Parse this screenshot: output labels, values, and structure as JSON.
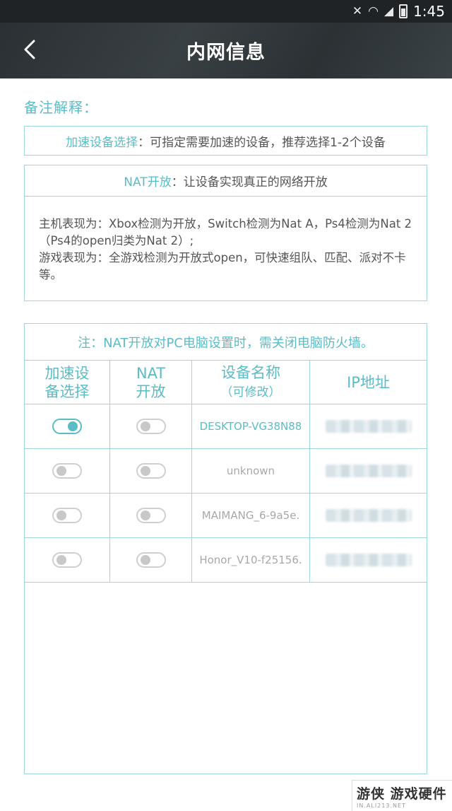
{
  "status_bar": {
    "time": "1:45",
    "icons": [
      "mute-icon",
      "wifi-icon",
      "signal-icon",
      "battery-icon"
    ]
  },
  "app_bar": {
    "title": "内网信息",
    "back_icon": "chevron-left-icon"
  },
  "notes": {
    "heading": "备注解释：",
    "device_select_term": "加速设备选择",
    "device_select_desc": "：可指定需要加速的设备，推荐选择1-2个设备",
    "nat_term": "NAT开放",
    "nat_desc": "：让设备实现真正的网络开放",
    "host_line": "主机表现为：Xbox检测为开放，Switch检测为Nat A，Ps4检测为Nat 2（Ps4的open归类为Nat 2）;",
    "game_line": "游戏表现为：全游戏检测为开放式open，可快速组队、匹配、派对不卡等。"
  },
  "devices": {
    "note": "注：NAT开放对PC电脑设置时，需关闭电脑防火墙。",
    "headers": {
      "accel_line1": "加速设",
      "accel_line2": "备选择",
      "nat_line1": "NAT",
      "nat_line2": "开放",
      "name_line1": "设备名称",
      "name_line2": "（可修改）",
      "ip": "IP地址"
    },
    "rows": [
      {
        "name": "DESKTOP-VG38N88",
        "accel_on": true,
        "nat_on": false,
        "active": true
      },
      {
        "name": "unknown",
        "accel_on": false,
        "nat_on": false,
        "active": false
      },
      {
        "name": "MAIMANG_6-9a5e.",
        "accel_on": false,
        "nat_on": false,
        "active": false
      },
      {
        "name": "Honor_V10-f25156.",
        "accel_on": false,
        "nat_on": false,
        "active": false
      }
    ]
  },
  "watermark": {
    "main": "游侠 游戏硬件",
    "sub": "IN.ALI213.NET"
  },
  "colors": {
    "accent": "#5bbcc6",
    "border": "#9fd6dc",
    "appbar": "#2f3538"
  }
}
